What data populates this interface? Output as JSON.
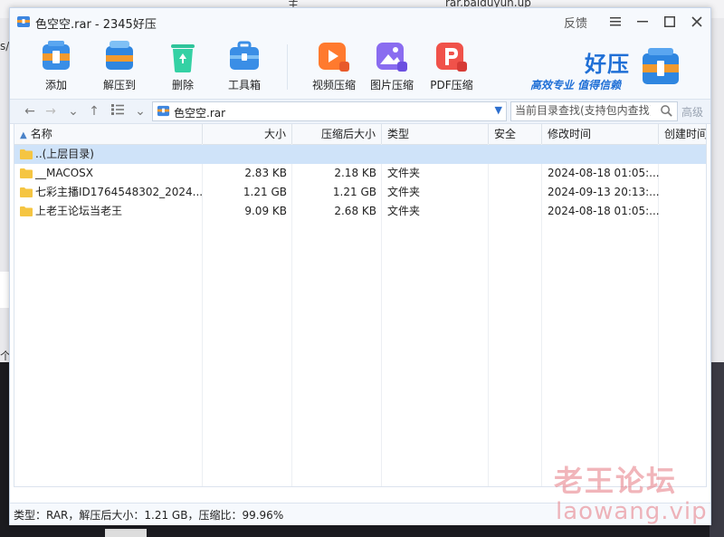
{
  "background": {
    "top_text_left": "主",
    "top_text_right": "rar.baiduyun.up",
    "left_edge_text_1": "s/",
    "left_edge_text_2": "个"
  },
  "window": {
    "title": "色空空.rar - 2345好压",
    "feedback": "反馈"
  },
  "toolbar": {
    "add": "添加",
    "extract": "解压到",
    "delete": "删除",
    "toolbox": "工具箱",
    "video": "视频压缩",
    "image": "图片压缩",
    "pdf": "PDF压缩"
  },
  "brand": {
    "name": "好压",
    "slogan": "高效专业  值得信赖"
  },
  "address": {
    "path": "色空空.rar",
    "search_placeholder": "当前目录查找(支持包内查找)",
    "advanced": "高级"
  },
  "columns": {
    "name": "名称",
    "size": "大小",
    "packed": "压缩后大小",
    "type": "类型",
    "security": "安全",
    "modified": "修改时间",
    "created": "创建时间"
  },
  "rows": [
    {
      "name": "..(上层目录)",
      "size": "",
      "packed": "",
      "type": "",
      "security": "",
      "modified": "",
      "created": ""
    },
    {
      "name": "__MACOSX",
      "size": "2.83 KB",
      "packed": "2.18 KB",
      "type": "文件夹",
      "security": "",
      "modified": "2024-08-18 01:05:...",
      "created": ""
    },
    {
      "name": "七彩主播ID1764548302_2024...",
      "size": "1.21 GB",
      "packed": "1.21 GB",
      "type": "文件夹",
      "security": "",
      "modified": "2024-09-13 20:13:...",
      "created": ""
    },
    {
      "name": "上老王论坛当老王",
      "size": "9.09 KB",
      "packed": "2.68 KB",
      "type": "文件夹",
      "security": "",
      "modified": "2024-08-18 01:05:...",
      "created": ""
    }
  ],
  "status": "类型：RAR，解压后大小：1.21 GB，压缩比：99.96%",
  "watermark": {
    "line1": "老王论坛",
    "line2": "laowang.vip"
  },
  "colors": {
    "accent": "#1f6fd6",
    "selection": "#cfe3f9",
    "folder": "#f5c542"
  }
}
